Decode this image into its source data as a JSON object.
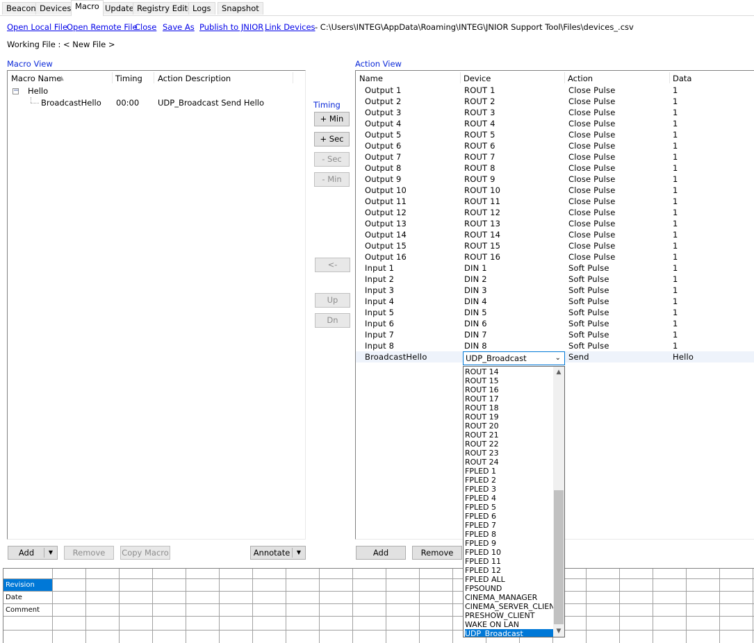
{
  "tabs": [
    {
      "label": "Beacon",
      "active": false
    },
    {
      "label": "Devices",
      "active": false
    },
    {
      "label": "Macro",
      "active": true
    },
    {
      "label": "Update",
      "active": false
    },
    {
      "label": "Registry Editor",
      "active": false
    },
    {
      "label": "Logs",
      "active": false
    },
    {
      "label": "Snapshot",
      "active": false
    }
  ],
  "toolbar": {
    "open_local": "Open Local File",
    "open_remote": "Open Remote File",
    "close": "Close",
    "save_as": "Save As",
    "publish": "Publish to JNIOR",
    "link_devices": "Link Devices",
    "file_path": "- C:\\Users\\INTEG\\AppData\\Roaming\\INTEG\\JNIOR Support Tool\\Files\\devices_.csv"
  },
  "working_file": "Working File : < New File >",
  "macro_view": {
    "title": "Macro View",
    "columns": [
      "Macro Name",
      "Timing",
      "Action Description"
    ],
    "macro": {
      "name": "Hello",
      "expander": "−"
    },
    "action": {
      "name": "BroadcastHello",
      "timing": "00:00",
      "description": "UDP_Broadcast Send Hello"
    }
  },
  "timing": {
    "label": "Timing",
    "plus_min": "+ Min",
    "plus_sec": "+ Sec",
    "minus_sec": "- Sec",
    "minus_min": "- Min",
    "move_left": "<-",
    "up": "Up",
    "down": "Dn"
  },
  "action_view": {
    "title": "Action View",
    "columns": [
      "Name",
      "Device",
      "Action",
      "Data"
    ],
    "rows": [
      [
        "Output 1",
        "ROUT 1",
        "Close Pulse",
        "1"
      ],
      [
        "Output 2",
        "ROUT 2",
        "Close Pulse",
        "1"
      ],
      [
        "Output 3",
        "ROUT 3",
        "Close Pulse",
        "1"
      ],
      [
        "Output 4",
        "ROUT 4",
        "Close Pulse",
        "1"
      ],
      [
        "Output 5",
        "ROUT 5",
        "Close Pulse",
        "1"
      ],
      [
        "Output 6",
        "ROUT 6",
        "Close Pulse",
        "1"
      ],
      [
        "Output 7",
        "ROUT 7",
        "Close Pulse",
        "1"
      ],
      [
        "Output 8",
        "ROUT 8",
        "Close Pulse",
        "1"
      ],
      [
        "Output 9",
        "ROUT 9",
        "Close Pulse",
        "1"
      ],
      [
        "Output 10",
        "ROUT 10",
        "Close Pulse",
        "1"
      ],
      [
        "Output 11",
        "ROUT 11",
        "Close Pulse",
        "1"
      ],
      [
        "Output 12",
        "ROUT 12",
        "Close Pulse",
        "1"
      ],
      [
        "Output 13",
        "ROUT 13",
        "Close Pulse",
        "1"
      ],
      [
        "Output 14",
        "ROUT 14",
        "Close Pulse",
        "1"
      ],
      [
        "Output 15",
        "ROUT 15",
        "Close Pulse",
        "1"
      ],
      [
        "Output 16",
        "ROUT 16",
        "Close Pulse",
        "1"
      ],
      [
        "Input 1",
        "DIN 1",
        "Soft Pulse",
        "1"
      ],
      [
        "Input 2",
        "DIN 2",
        "Soft Pulse",
        "1"
      ],
      [
        "Input 3",
        "DIN 3",
        "Soft Pulse",
        "1"
      ],
      [
        "Input 4",
        "DIN 4",
        "Soft Pulse",
        "1"
      ],
      [
        "Input 5",
        "DIN 5",
        "Soft Pulse",
        "1"
      ],
      [
        "Input 6",
        "DIN 6",
        "Soft Pulse",
        "1"
      ],
      [
        "Input 7",
        "DIN 7",
        "Soft Pulse",
        "1"
      ],
      [
        "Input 8",
        "DIN 8",
        "Soft Pulse",
        "1"
      ],
      [
        "BroadcastHello",
        "UDP_Broadcast",
        "Send",
        "Hello"
      ]
    ]
  },
  "device_dropdown": {
    "selected": "UDP_Broadcast",
    "options": [
      "ROUT 14",
      "ROUT 15",
      "ROUT 16",
      "ROUT 17",
      "ROUT 18",
      "ROUT 19",
      "ROUT 20",
      "ROUT 21",
      "ROUT 22",
      "ROUT 23",
      "ROUT 24",
      "FPLED 1",
      "FPLED 2",
      "FPLED 3",
      "FPLED 4",
      "FPLED 5",
      "FPLED 6",
      "FPLED 7",
      "FPLED 8",
      "FPLED 9",
      "FPLED 10",
      "FPLED 11",
      "FPLED 12",
      "FPLED ALL",
      "FPSOUND",
      "CINEMA_MANAGER",
      "CINEMA_SERVER_CLIENT",
      "PRESHOW_CLIENT",
      "WAKE ON LAN",
      "UDP_Broadcast"
    ]
  },
  "macro_buttons": {
    "add": "Add",
    "remove": "Remove",
    "copy": "Copy Macro",
    "annotate": "Annotate"
  },
  "action_buttons": {
    "add": "Add",
    "remove": "Remove"
  },
  "annotation_grid": {
    "rows": [
      "Revision",
      "Date",
      "Comment"
    ],
    "selected": "Revision"
  },
  "colors": {
    "link": "#0000e8",
    "section_title": "#0a28d8",
    "selection": "#0078d7"
  }
}
